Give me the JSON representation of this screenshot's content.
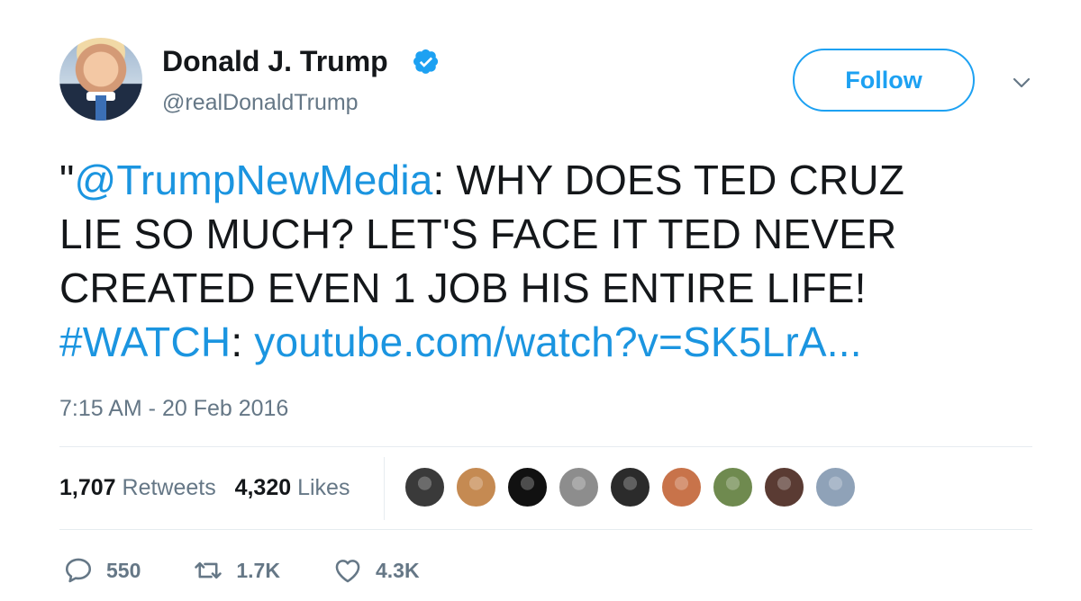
{
  "author": {
    "name": "Donald J. Trump",
    "handle": "@realDonaldTrump",
    "verified": true
  },
  "header": {
    "follow_label": "Follow"
  },
  "tweet": {
    "line1_prefix": "\"",
    "mention": "@TrumpNewMedia",
    "line1_rest": ": WHY DOES TED CRUZ",
    "line2": "LIE SO MUCH? LET'S FACE IT TED NEVER",
    "line3": "CREATED EVEN 1 JOB HIS ENTIRE LIFE!",
    "hashtag": "#WATCH",
    "line4_sep": ": ",
    "url": "youtube.com/watch?v=SK5LrA..."
  },
  "timestamp": "7:15 AM - 20 Feb 2016",
  "stats": {
    "retweets_count": "1,707",
    "retweets_label": "Retweets",
    "likes_count": "4,320",
    "likes_label": "Likes"
  },
  "likers": [
    {
      "color": "#3a3a3a"
    },
    {
      "color": "#c58a52"
    },
    {
      "color": "#111111"
    },
    {
      "color": "#8d8d8d"
    },
    {
      "color": "#2b2b2b"
    },
    {
      "color": "#c8734a"
    },
    {
      "color": "#6f8a4f"
    },
    {
      "color": "#5a3b33"
    },
    {
      "color": "#8fa2b8"
    }
  ],
  "actions": {
    "replies": "550",
    "retweets": "1.7K",
    "likes": "4.3K"
  },
  "colors": {
    "accent": "#1da1f2",
    "link": "#1b95e0",
    "muted": "#657786"
  }
}
